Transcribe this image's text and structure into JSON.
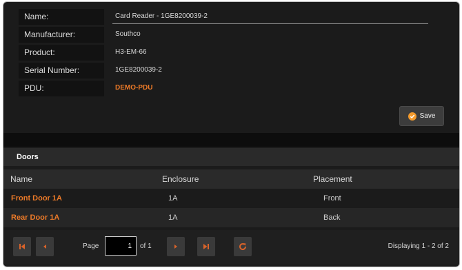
{
  "properties": {
    "name_label": "Name:",
    "name_value": "Card Reader - 1GE8200039-2",
    "manufacturer_label": "Manufacturer:",
    "manufacturer_value": "Southco",
    "product_label": "Product:",
    "product_value": "H3-EM-66",
    "serial_label": "Serial Number:",
    "serial_value": "1GE8200039-2",
    "pdu_label": "PDU:",
    "pdu_value": "DEMO-PDU"
  },
  "save_button": {
    "label": "Save"
  },
  "doors": {
    "title": "Doors",
    "columns": [
      "Name",
      "Enclosure",
      "Placement"
    ],
    "rows": [
      {
        "name": "Front Door 1A",
        "enclosure": "1A",
        "placement": "Front"
      },
      {
        "name": "Rear Door 1A",
        "enclosure": "1A",
        "placement": "Back"
      }
    ]
  },
  "pager": {
    "page_label": "Page",
    "page_value": "1",
    "of_label": "of 1",
    "displaying": "Displaying 1 - 2 of 2"
  },
  "colors": {
    "accent": "#ec7a28",
    "pager_icon": "#d9632a",
    "save_icon": "#f39a2c"
  }
}
